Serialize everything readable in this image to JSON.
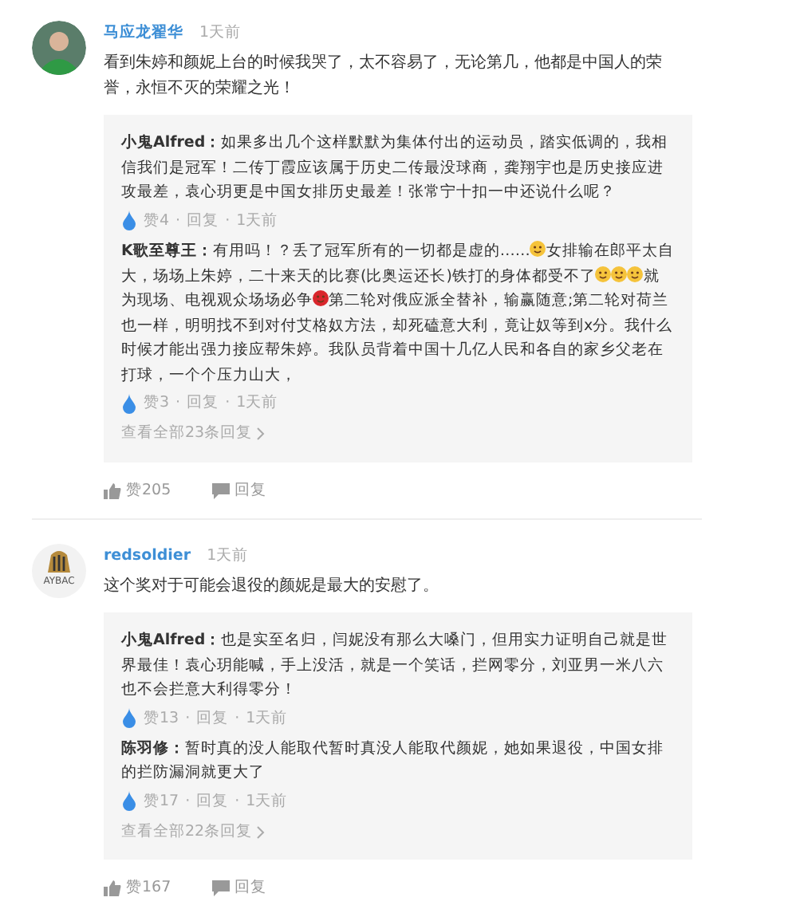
{
  "comments": [
    {
      "avatar": {
        "kind": "photo"
      },
      "user": "马应龙翟华",
      "time": "1天前",
      "text": "看到朱婷和颜妮上台的时候我哭了，太不容易了，无论第几，他都是中国人的荣誉，永恒不灭的荣耀之光！",
      "replies": [
        {
          "author": "小鬼Alfred",
          "colon": "：",
          "segments": [
            {
              "kind": "text",
              "text": "如果多出几个这样默默为集体付出的运动员，踏实低调的，我相信我们是冠军！二传丁霞应该属于历史二传最没球商，龚翔宇也是历史接应进攻最差，袁心玥更是中国女排历史最差！张常宁十扣一中还说什么呢？"
            }
          ],
          "meta": [
            "赞4",
            "·",
            "回复",
            "·",
            "1天前"
          ]
        },
        {
          "author": "K歌至尊王",
          "colon": "：",
          "segments": [
            {
              "kind": "text",
              "text": "有用吗！？丢了冠军所有的一切都是虚的……"
            },
            {
              "kind": "emoji",
              "color": "#f5c33b"
            },
            {
              "kind": "text",
              "text": "女排输在郎平太自大，场场上朱婷，二十来天的比赛(比奥运还长)铁打的身体都受不了"
            },
            {
              "kind": "emoji",
              "color": "#f5c33b"
            },
            {
              "kind": "emoji",
              "color": "#f5c33b"
            },
            {
              "kind": "emoji",
              "color": "#f5c33b"
            },
            {
              "kind": "text",
              "text": "就为现场、电视观众场场必争"
            },
            {
              "kind": "emoji",
              "color": "#d9262c"
            },
            {
              "kind": "text",
              "text": "第二轮对俄应派全替补，输赢随意;第二轮对荷兰也一样，明明找不到对付艾格奴方法，却死磕意大利，竟让奴等到x分。我什么时候才能出强力接应帮朱婷。我队员背着中国十几亿人民和各自的家乡父老在打球，一个个压力山大，"
            }
          ],
          "meta": [
            "赞3",
            "·",
            "回复",
            "·",
            "1天前"
          ]
        }
      ],
      "view_all": "查看全部23条回复",
      "likes": "赞205",
      "reply": "回复"
    },
    {
      "avatar": {
        "kind": "logo",
        "caption": "AYBAC"
      },
      "user": "redsoldier",
      "time": "1天前",
      "text": "这个奖对于可能会退役的颜妮是最大的安慰了。",
      "replies": [
        {
          "author": "小鬼Alfred",
          "colon": "：",
          "segments": [
            {
              "kind": "text",
              "text": "也是实至名归，闫妮没有那么大嗓门，但用实力证明自己就是世界最佳！袁心玥能喊，手上没活，就是一个笑话，拦网零分，刘亚男一米八六也不会拦意大利得零分！"
            }
          ],
          "meta": [
            "赞13",
            "·",
            "回复",
            "·",
            "1天前"
          ]
        },
        {
          "author": "陈羽修",
          "colon": "：",
          "segments": [
            {
              "kind": "text",
              "text": "暂时真的没人能取代暂时真没人能取代颜妮，她如果退役，中国女排的拦防漏洞就更大了"
            }
          ],
          "meta": [
            "赞17",
            "·",
            "回复",
            "·",
            "1天前"
          ]
        }
      ],
      "view_all": "查看全部22条回复",
      "likes": "赞167",
      "reply": "回复"
    }
  ]
}
